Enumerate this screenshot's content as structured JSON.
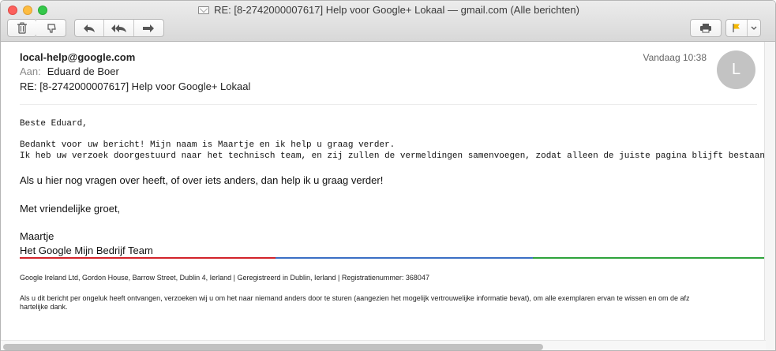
{
  "window": {
    "title": "RE: [8-2742000007617] Help voor Google+ Lokaal — gmail.com (Alle berichten)"
  },
  "toolbar": {
    "icons": [
      "trash-icon",
      "junk-icon",
      "reply-icon",
      "reply-all-icon",
      "forward-icon",
      "print-icon",
      "flag-icon",
      "chevron-down-icon"
    ],
    "flag_color": "#f5b800"
  },
  "message": {
    "from": "local-help@google.com",
    "to_label": "Aan:",
    "to": "Eduard de Boer",
    "subject": "RE: [8-2742000007617] Help voor Google+ Lokaal",
    "date": "Vandaag 10:38",
    "avatar_initial": "L"
  },
  "body": {
    "greeting": "Beste Eduard,",
    "line1": "Bedankt voor uw bericht! Mijn naam is Maartje en ik help u graag verder.",
    "line2": "Ik heb uw verzoek doorgestuurd naar het technisch team, en zij zullen de vermeldingen samenvoegen, zodat alleen de juiste pagina blijft bestaan.",
    "para3": "Als u hier nog vragen over heeft, of over iets anders, dan help ik u graag verder!",
    "closing": "Met vriendelijke groet,",
    "sig_name": "Maartje",
    "sig_team": "Het Google Mijn Bedrijf Team"
  },
  "footer": {
    "address": "Google Ireland Ltd, Gordon House, Barrow Street, Dublin 4, Ierland   |   Geregistreerd in Dublin, Ierland   |   Registratienummer: 368047",
    "disclaimer1": "Als u dit bericht per ongeluk heeft ontvangen, verzoeken wij u om het naar niemand anders door te sturen (aangezien het mogelijk vertrouwelijke informatie bevat), om alle exemplaren ervan te wissen en om de afz",
    "disclaimer2": "hartelijke dank."
  },
  "colors": {
    "brand_red": "#d2232a",
    "brand_blue": "#3b6fc5",
    "brand_green": "#2ea33c"
  },
  "scroll": {
    "horizontal_visible_fraction": 0.71
  }
}
